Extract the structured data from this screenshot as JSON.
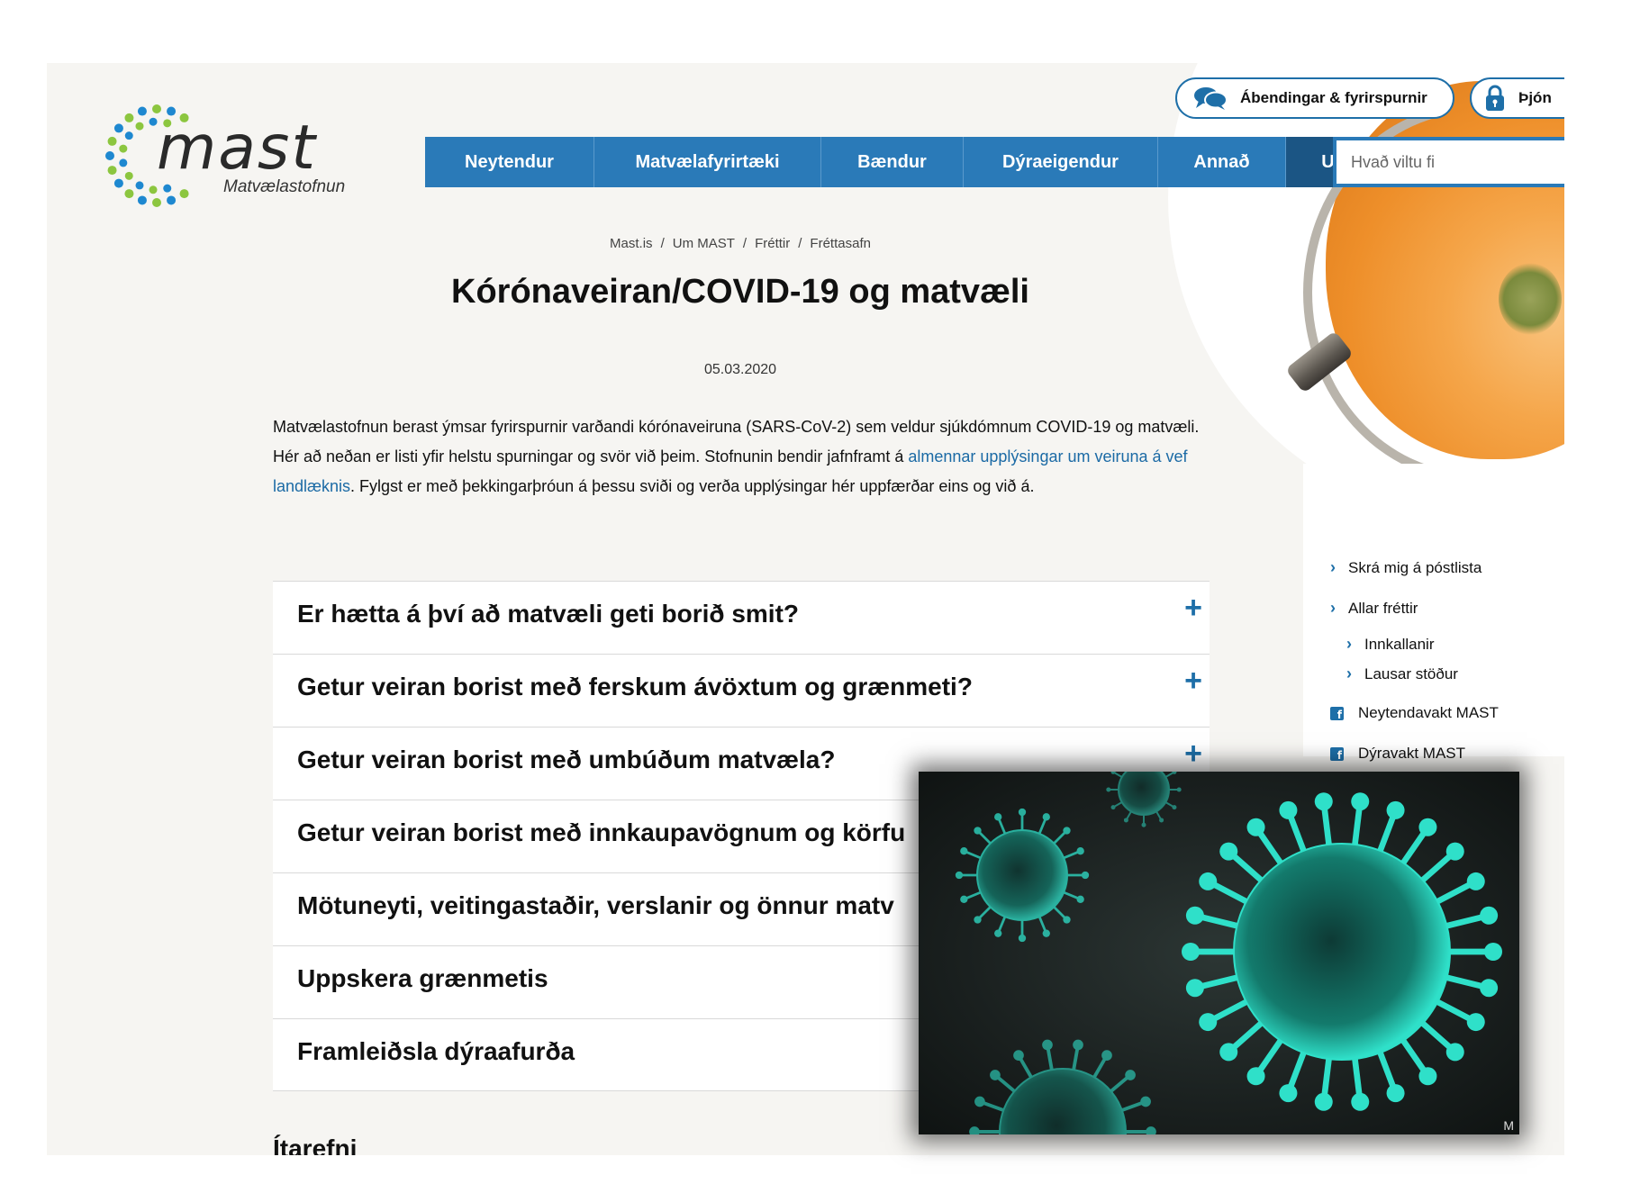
{
  "logo": {
    "word": "mast",
    "subtitle": "Matvælastofnun"
  },
  "top_links": {
    "feedback": "Ábendingar & fyrirspurnir",
    "service": "Þjón"
  },
  "nav": {
    "items": [
      "Neytendur",
      "Matvælafyrirtæki",
      "Bændur",
      "Dýraeigendur",
      "Annað",
      "Um MAST"
    ],
    "active_index": 5
  },
  "search": {
    "placeholder": "Hvað viltu fi"
  },
  "breadcrumb": [
    "Mast.is",
    "Um MAST",
    "Fréttir",
    "Fréttasafn"
  ],
  "article": {
    "title": "Kórónaveiran/COVID-19 og matvæli",
    "date": "05.03.2020",
    "intro_part1": "Matvælastofnun berast ýmsar fyrirspurnir varðandi kórónaveiruna (SARS-CoV-2) sem veldur sjúkdómnum COVID-19 og matvæli. Hér að neðan er listi yfir helstu spurningar og svör við þeim. Stofnunin bendir jafnframt á ",
    "intro_link": "almennar upplýsingar um veiruna á vef landlæknis",
    "intro_part2": ". Fylgst er með þekkingarþróun á þessu sviði og verða upplýsingar hér uppfærðar eins og við á."
  },
  "accordion": [
    "Er hætta á því að matvæli geti borið smit?",
    "Getur veiran borist með ferskum ávöxtum og grænmeti?",
    "Getur veiran borist með umbúðum matvæla?",
    "Getur veiran borist með innkaupavögnum og körfu",
    "Mötuneyti, veitingastaðir, verslanir og önnur matv",
    "Uppskera grænmetis",
    "Framleiðsla dýraafurða"
  ],
  "accordion_plus": "+",
  "next_heading": "Ítarefni",
  "sidebar": {
    "links": [
      {
        "label": "Skrá mig á póstlista",
        "icon": "chevron-right-icon"
      },
      {
        "label": "Allar fréttir",
        "icon": "chevron-right-icon"
      },
      {
        "label": "Innkallanir",
        "icon": "chevron-right-icon"
      },
      {
        "label": "Lausar stöður",
        "icon": "chevron-right-icon"
      },
      {
        "label": "Neytendavakt MAST",
        "icon": "facebook-icon"
      },
      {
        "label": "Dýravakt MAST",
        "icon": "facebook-icon"
      }
    ]
  },
  "image_credit": "M",
  "colors": {
    "brand_blue": "#2a7ab8",
    "nav_active": "#1b5584",
    "link": "#1b6aa5",
    "logo_green": "#8cc63f",
    "logo_blue": "#1e88d0",
    "virus_cyan": "#2fe0c9"
  }
}
